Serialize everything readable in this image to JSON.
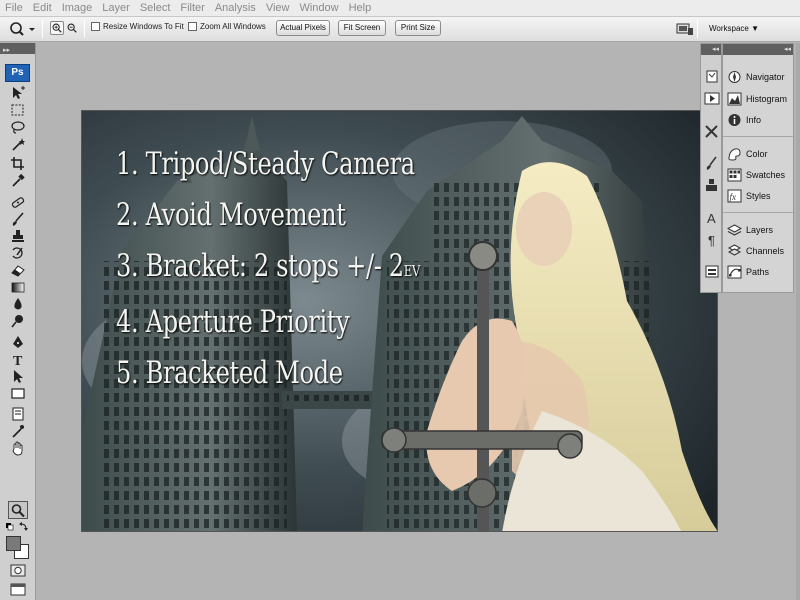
{
  "menu": [
    "File",
    "Edit",
    "Image",
    "Layer",
    "Select",
    "Filter",
    "Analysis",
    "View",
    "Window",
    "Help"
  ],
  "options": {
    "resize_windows_label": "Resize Windows To Fit",
    "zoom_all_label": "Zoom All Windows",
    "actual_pixels_label": "Actual Pixels",
    "fit_screen_label": "Fit Screen",
    "print_size_label": "Print Size",
    "workspace_label": "Workspace ▼"
  },
  "tools": {
    "logo": "Ps"
  },
  "canvas": {
    "lines": [
      "1. Tripod/Steady Camera",
      "2. Avoid Movement",
      "3. Bracket: 2 stops +/- 2",
      "4. Aperture Priority",
      "5. Bracketed Mode"
    ],
    "ev_suffix": "EV"
  },
  "panels": {
    "items": [
      {
        "label": "Navigator",
        "icon": "navigator-icon"
      },
      {
        "label": "Histogram",
        "icon": "histogram-icon"
      },
      {
        "label": "Info",
        "icon": "info-icon"
      },
      {
        "label": "Color",
        "icon": "color-icon"
      },
      {
        "label": "Swatches",
        "icon": "swatches-icon"
      },
      {
        "label": "Styles",
        "icon": "styles-icon"
      },
      {
        "label": "Layers",
        "icon": "layers-icon"
      },
      {
        "label": "Channels",
        "icon": "channels-icon"
      },
      {
        "label": "Paths",
        "icon": "paths-icon"
      }
    ]
  },
  "colors": {
    "ps_blue": "#1f62b6",
    "workspace_bg": "#b4b4b4",
    "panel_header": "#5f5f5f"
  }
}
